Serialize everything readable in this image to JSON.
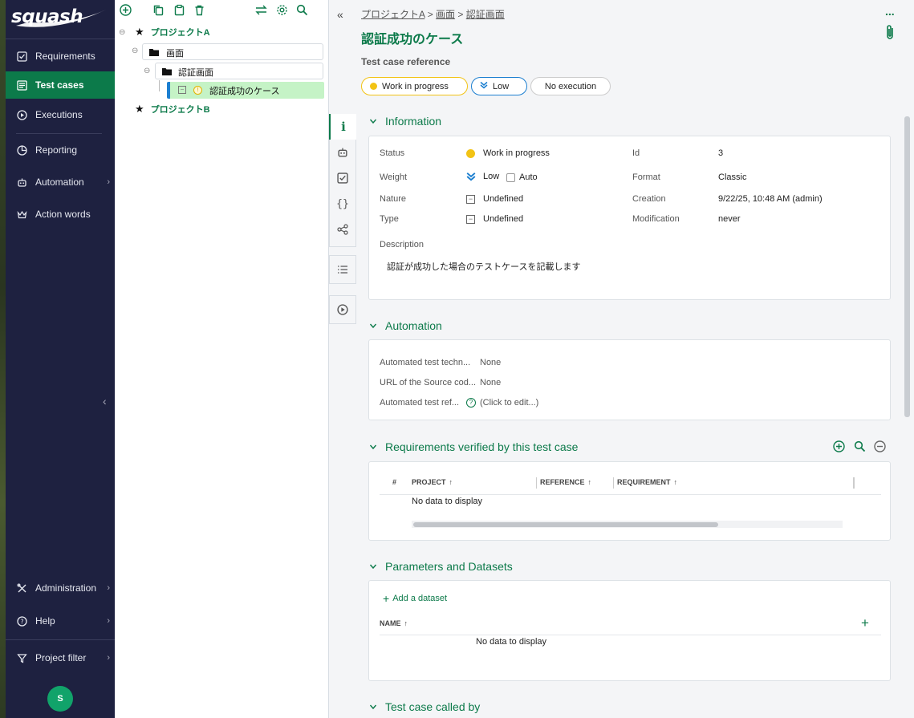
{
  "nav": {
    "logo_text": "squash",
    "items": [
      {
        "label": "Requirements",
        "icon": "checkbox-icon"
      },
      {
        "label": "Test cases",
        "icon": "test-cases-icon"
      },
      {
        "label": "Executions",
        "icon": "play-circle-icon"
      },
      {
        "label": "Reporting",
        "icon": "pie-chart-icon"
      },
      {
        "label": "Automation",
        "icon": "robot-icon"
      },
      {
        "label": "Action words",
        "icon": "crown-icon"
      },
      {
        "label": "Administration",
        "icon": "tools-icon"
      },
      {
        "label": "Help",
        "icon": "help-circle-icon"
      },
      {
        "label": "Project filter",
        "icon": "filter-icon"
      }
    ],
    "avatar_initial": "S",
    "active_color": "#0c7a4a"
  },
  "tree": {
    "project_a": "プロジェクトA",
    "folder_1": "画面",
    "folder_2": "認証画面",
    "test_case": "認証成功のケース",
    "project_b": "プロジェクトB"
  },
  "header": {
    "breadcrumb": [
      "プロジェクトA",
      "画面",
      "認証画面"
    ],
    "breadcrumb_sep": ">",
    "title": "認証成功のケース",
    "subtitle": "Test case reference",
    "pills": {
      "status": "Work in progress",
      "weight": "Low",
      "execution": "No execution"
    },
    "more": "..."
  },
  "information": {
    "heading": "Information",
    "status_label": "Status",
    "status_value": "Work in progress",
    "weight_label": "Weight",
    "weight_value": "Low",
    "auto_label": "Auto",
    "nature_label": "Nature",
    "nature_value": "Undefined",
    "type_label": "Type",
    "type_value": "Undefined",
    "id_label": "Id",
    "id_value": "3",
    "format_label": "Format",
    "format_value": "Classic",
    "creation_label": "Creation",
    "creation_value": "9/22/25, 10:48 AM (admin)",
    "modification_label": "Modification",
    "modification_value": "never",
    "description_label": "Description",
    "description_value": "認証が成功した場合のテストケースを記載します"
  },
  "automation": {
    "heading": "Automation",
    "tech_label": "Automated test techn...",
    "tech_value": "None",
    "url_label": "URL of the Source cod...",
    "url_value": "None",
    "ref_label": "Automated test ref...",
    "ref_value": "(Click to edit...)"
  },
  "requirements": {
    "heading": "Requirements verified by this test case",
    "columns": [
      "#",
      "PROJECT",
      "REFERENCE",
      "REQUIREMENT"
    ],
    "empty": "No data to display"
  },
  "parameters": {
    "heading": "Parameters and Datasets",
    "add_dataset": "Add a dataset",
    "column": "NAME",
    "empty": "No data to display"
  },
  "called_by": {
    "heading": "Test case called by"
  }
}
